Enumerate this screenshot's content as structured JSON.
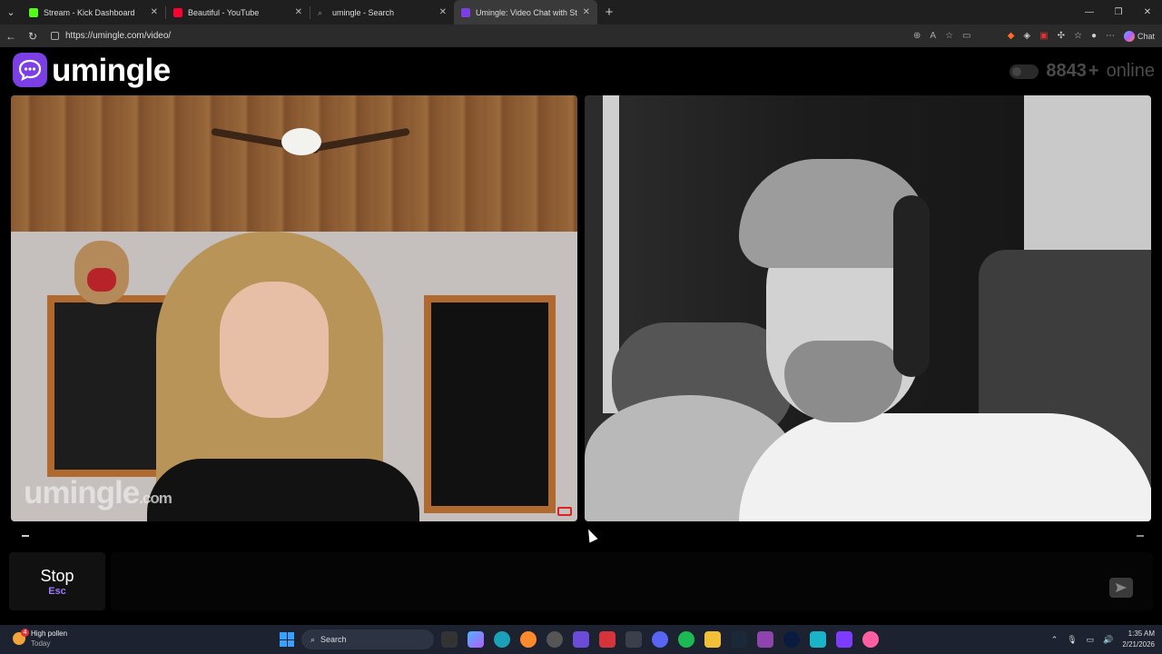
{
  "browser": {
    "tabs": [
      {
        "title": "Stream - Kick Dashboard",
        "color": "#53fc18",
        "active": false
      },
      {
        "title": "Beautiful - YouTube",
        "color": "#ff0033",
        "active": false
      },
      {
        "title": "umingle - Search",
        "color": "#777777",
        "active": false
      },
      {
        "title": "Umingle: Video Chat with Str",
        "color": "#7b3fe4",
        "active": true
      }
    ],
    "new_tab_label": "+",
    "url": "https://umingle.com/video/",
    "chat_label": "Chat"
  },
  "site": {
    "logo_text": "umingle",
    "online_count": "8843",
    "online_plus": "+",
    "online_label": "online",
    "accent": "#7b3fe4"
  },
  "video": {
    "watermark_main": "umingle",
    "watermark_suffix": ".com"
  },
  "controls": {
    "stop_label": "Stop",
    "stop_key": "Esc",
    "dash_left": "–",
    "dash_right": "–"
  },
  "taskbar": {
    "weather_title": "High pollen",
    "weather_sub": "Today",
    "weather_badge": "4",
    "search_label": "Search",
    "time": "1:35 AM",
    "date": "2/21/2026"
  }
}
